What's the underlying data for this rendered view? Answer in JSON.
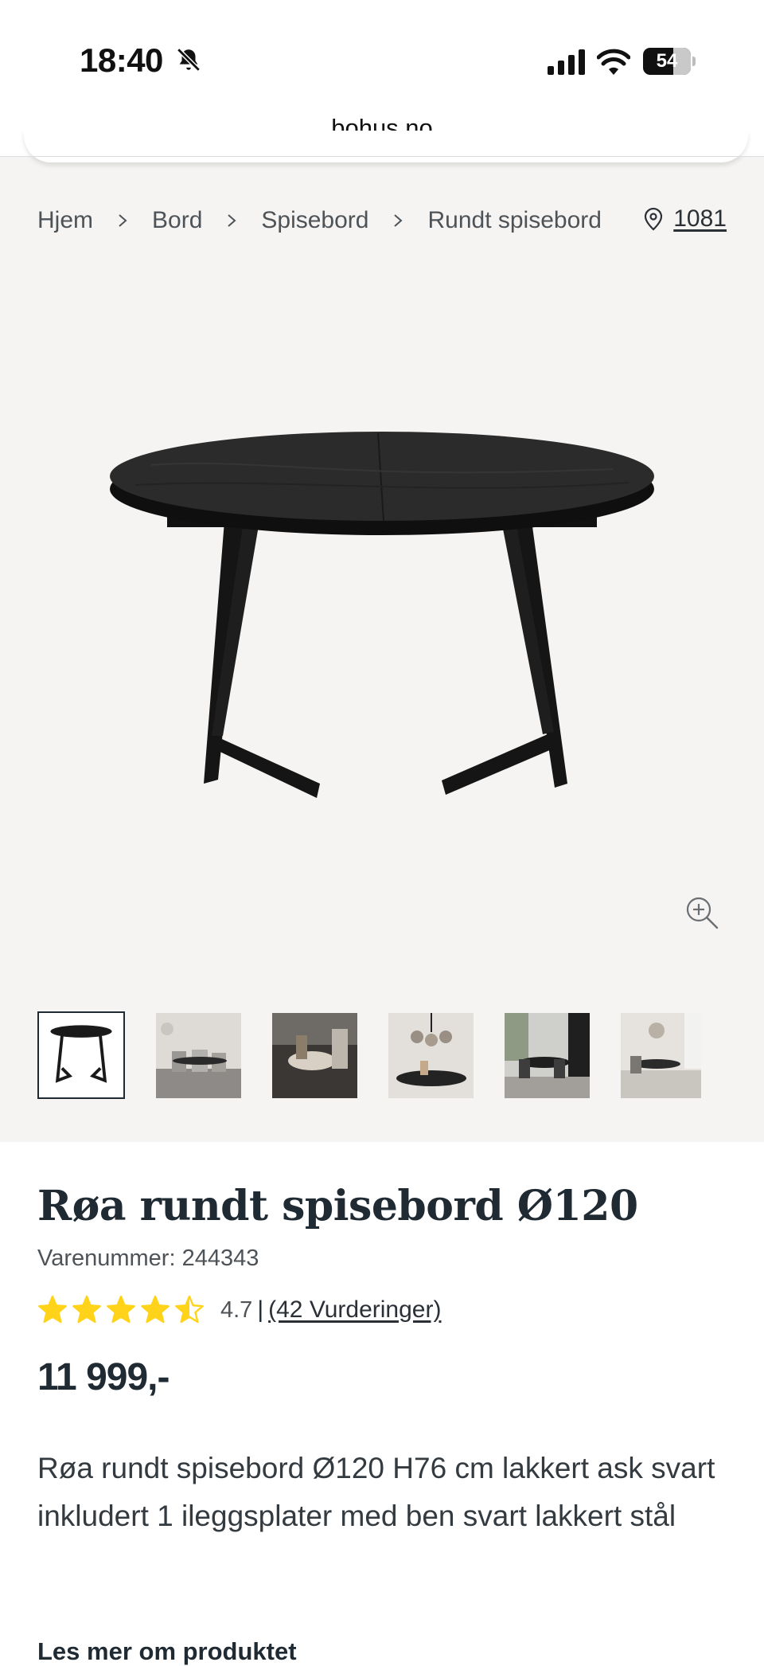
{
  "status_bar": {
    "time": "18:40",
    "battery": "54"
  },
  "browser": {
    "url": "bohus.no"
  },
  "breadcrumb": [
    "Hjem",
    "Bord",
    "Spisebord",
    "Rundt spisebord"
  ],
  "store": {
    "code": "1081"
  },
  "gallery": {
    "thumbnails": [
      {
        "icon": "table-product-image"
      },
      {
        "icon": "dining-room-photo"
      },
      {
        "icon": "table-detail-photo"
      },
      {
        "icon": "pendant-lamp-photo"
      },
      {
        "icon": "dining-set-photo"
      },
      {
        "icon": "dining-room-photo"
      }
    ]
  },
  "product": {
    "title": "Røa rundt spisebord Ø120",
    "sku_label": "Varenummer: 244343",
    "rating_value": "4.7",
    "rating_separator": "|",
    "rating_link": "(42 Vurderinger)",
    "rating_stars": 4.7,
    "price": "11 999,-",
    "description": "Røa rundt spisebord Ø120 H76 cm lakkert ask svart inkludert 1 ileggsplater med ben svart lakkert stål",
    "read_more": "Les mer om produktet"
  },
  "colors": {
    "text": "#1f2a33",
    "star": "#ffd31a",
    "background_gray": "#f5f4f2"
  }
}
